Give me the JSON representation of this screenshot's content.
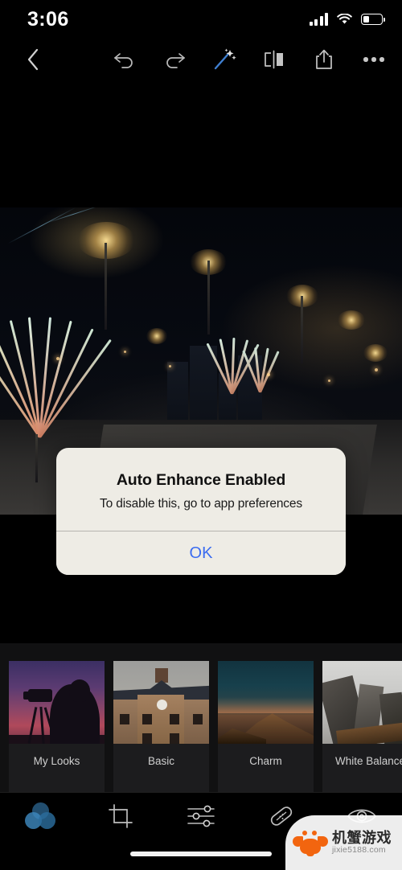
{
  "status_bar": {
    "time": "3:06",
    "signal_icon": "cellular-signal-icon",
    "wifi_icon": "wifi-icon",
    "battery_icon": "battery-icon",
    "battery_level_percent": 33
  },
  "top_toolbar": {
    "back_label": "‹",
    "back_icon": "chevron-left-icon",
    "buttons": [
      {
        "name": "undo",
        "icon": "undo-icon",
        "label": "Undo"
      },
      {
        "name": "redo",
        "icon": "redo-icon",
        "label": "Redo"
      },
      {
        "name": "auto-enhance",
        "icon": "magic-wand-icon",
        "label": "Auto Enhance",
        "active": true,
        "accent": "#3f7fd0"
      },
      {
        "name": "compare",
        "icon": "before-after-compare-icon",
        "label": "Compare"
      },
      {
        "name": "share",
        "icon": "share-icon",
        "label": "Share"
      },
      {
        "name": "more",
        "icon": "more-options-icon",
        "label": "More"
      }
    ]
  },
  "canvas": {
    "photo_description": "Night city plaza with illuminated fiber-optic light sculptures, street lamps and a paved walkway"
  },
  "dialog": {
    "visible": true,
    "title": "Auto Enhance Enabled",
    "message": "To disable this, go to app preferences",
    "ok_label": "OK",
    "ok_color": "#3b6cf0",
    "background": "#eeece5"
  },
  "presets": [
    {
      "label": "My Looks",
      "thumb": "photographer-silhouette-sunset"
    },
    {
      "label": "Basic",
      "thumb": "brick-house-with-clock"
    },
    {
      "label": "Charm",
      "thumb": "mountain-at-dusk"
    },
    {
      "label": "White Balance",
      "thumb": "skyscrapers-from-below"
    }
  ],
  "bottom_nav": [
    {
      "name": "looks",
      "icon": "looks-circles-icon",
      "label": "Looks",
      "active": true,
      "accent": "#3d87bd"
    },
    {
      "name": "crop",
      "icon": "crop-icon",
      "label": "Crop",
      "active": false
    },
    {
      "name": "adjust",
      "icon": "sliders-icon",
      "label": "Adjust",
      "active": false
    },
    {
      "name": "heal",
      "icon": "bandage-heal-icon",
      "label": "Heal",
      "active": false
    },
    {
      "name": "red-eye",
      "icon": "eye-icon",
      "label": "Red Eye",
      "active": false
    }
  ],
  "home_indicator": {
    "icon": "home-indicator"
  },
  "watermark": {
    "logo_icon": "crab-logo-icon",
    "name": "机蟹游戏",
    "url": "jixie5188.com"
  }
}
